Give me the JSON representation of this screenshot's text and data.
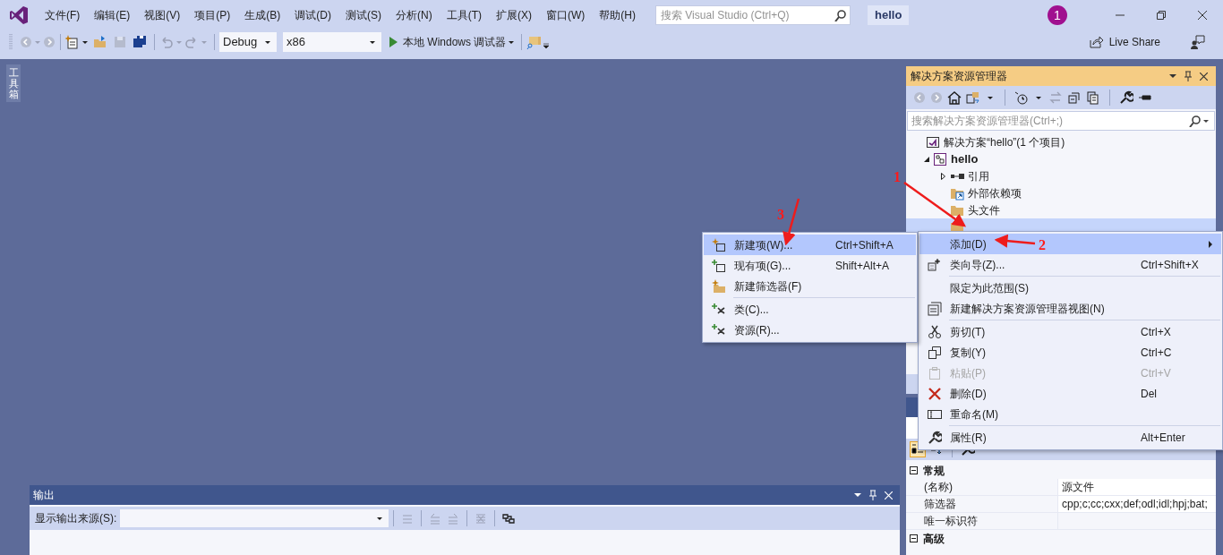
{
  "title_bar": {
    "menu": [
      "文件(F)",
      "编辑(E)",
      "视图(V)",
      "项目(P)",
      "生成(B)",
      "调试(D)",
      "测试(S)",
      "分析(N)",
      "工具(T)",
      "扩展(X)",
      "窗口(W)",
      "帮助(H)"
    ],
    "search": {
      "placeholder": "搜索 Visual Studio (Ctrl+Q)"
    },
    "project_name": "hello",
    "notification_count": "1"
  },
  "toolbar": {
    "configuration": "Debug",
    "platform": "x86",
    "run_target": "本地 Windows 调试器",
    "live_share": "Live Share"
  },
  "toolbox_tab": "工具箱",
  "solution_explorer": {
    "title": "解决方案资源管理器",
    "search": {
      "placeholder": "搜索解决方案资源管理器(Ctrl+;)"
    },
    "tree": [
      {
        "label": "解决方案“hello”(1 个项目)",
        "kind": "solution",
        "selected": false,
        "children": [
          {
            "label": "hello",
            "kind": "project",
            "expanded": true,
            "selected": false,
            "children": [
              {
                "label": "引用",
                "kind": "references",
                "expanded": false,
                "selected": false
              },
              {
                "label": "外部依赖项",
                "kind": "external",
                "selected": false
              },
              {
                "label": "头文件",
                "kind": "folder",
                "selected": false
              },
              {
                "kind": "folder",
                "selected": true
              }
            ]
          }
        ]
      }
    ]
  },
  "properties": {
    "categories": [
      {
        "name": "常规",
        "expanded": true,
        "rows": [
          {
            "name": "(名称)",
            "value": "源文件"
          },
          {
            "name": "筛选器",
            "value": "cpp;c;cc;cxx;def;odl;idl;hpj;bat;"
          },
          {
            "name": "唯一标识符"
          }
        ]
      },
      {
        "name": "高级",
        "expanded": true
      }
    ]
  },
  "output": {
    "title": "输出",
    "source_label": "显示输出来源(S):"
  },
  "context_menu": {
    "items": [
      {
        "kind": "item",
        "label": "添加(D)",
        "submenu": true,
        "selected": true,
        "disabled": false
      },
      {
        "kind": "item",
        "label": "类向导(Z)...",
        "shortcut": "Ctrl+Shift+X",
        "selected": false,
        "disabled": false
      },
      {
        "kind": "separator"
      },
      {
        "kind": "item",
        "label": "限定为此范围(S)",
        "selected": false,
        "disabled": false
      },
      {
        "kind": "item",
        "label": "新建解决方案资源管理器视图(N)",
        "selected": false,
        "disabled": false
      },
      {
        "kind": "separator"
      },
      {
        "kind": "item",
        "label": "剪切(T)",
        "shortcut": "Ctrl+X",
        "selected": false,
        "disabled": false
      },
      {
        "kind": "item",
        "label": "复制(Y)",
        "shortcut": "Ctrl+C",
        "selected": false,
        "disabled": false
      },
      {
        "kind": "item",
        "label": "粘贴(P)",
        "shortcut": "Ctrl+V",
        "selected": false,
        "disabled": true
      },
      {
        "kind": "item",
        "label": "删除(D)",
        "shortcut": "Del",
        "selected": false,
        "disabled": false
      },
      {
        "kind": "item",
        "label": "重命名(M)",
        "selected": false,
        "disabled": false
      },
      {
        "kind": "separator"
      },
      {
        "kind": "item",
        "label": "属性(R)",
        "shortcut": "Alt+Enter",
        "selected": false,
        "disabled": false
      }
    ]
  },
  "add_submenu": {
    "items": [
      {
        "kind": "item",
        "label": "新建项(W)...",
        "shortcut": "Ctrl+Shift+A",
        "selected": true
      },
      {
        "kind": "item",
        "label": "现有项(G)...",
        "shortcut": "Shift+Alt+A",
        "selected": false
      },
      {
        "kind": "item",
        "label": "新建筛选器(F)",
        "selected": false
      },
      {
        "kind": "separator"
      },
      {
        "kind": "item",
        "label": "类(C)...",
        "selected": false
      },
      {
        "kind": "item",
        "label": "资源(R)...",
        "selected": false
      }
    ]
  },
  "annotations": [
    {
      "label": "1"
    },
    {
      "label": "2"
    },
    {
      "label": "3"
    }
  ]
}
